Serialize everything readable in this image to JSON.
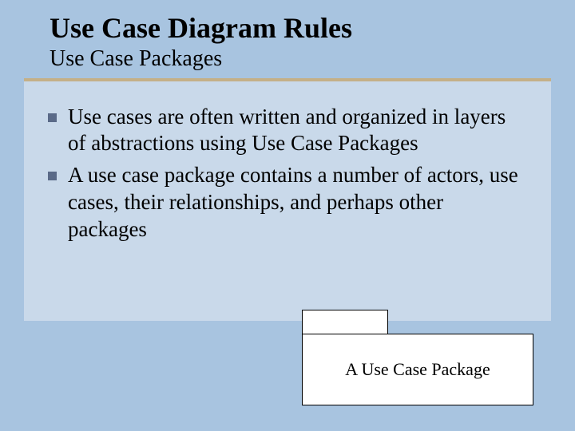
{
  "title": "Use Case Diagram Rules",
  "subtitle": "Use Case Packages",
  "bullets": [
    "Use cases are often written and organized in layers of abstractions using Use Case Packages",
    "A use case package contains a number of actors, use cases, their relationships, and perhaps other packages"
  ],
  "package_label": "A Use Case Package"
}
